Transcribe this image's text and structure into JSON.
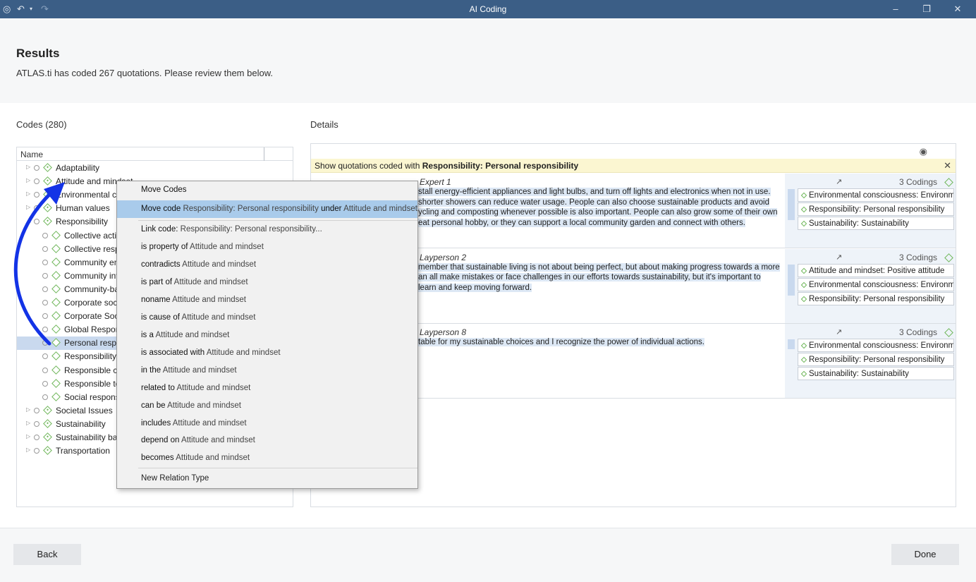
{
  "window": {
    "title": "AI Coding",
    "icons": [
      "app-icon",
      "undo-icon",
      "redo-icon"
    ],
    "controls": [
      "minimize-icon",
      "restore-icon",
      "close-icon"
    ]
  },
  "header": {
    "title": "Results",
    "subtitle": "ATLAS.ti has coded 267 quotations. Please review them below."
  },
  "codes": {
    "label": "Codes (280)",
    "column_name": "Name",
    "rows": [
      {
        "label": "Adaptability",
        "level": 0
      },
      {
        "label": "Attitude and mindset",
        "level": 0
      },
      {
        "label": "Environmental consciousness",
        "level": 0
      },
      {
        "label": "Human values",
        "level": 0
      },
      {
        "label": "Responsibility",
        "level": 0,
        "expanded": true
      },
      {
        "label": "Collective action",
        "level": 1
      },
      {
        "label": "Collective responsibility",
        "level": 1
      },
      {
        "label": "Community engagement",
        "level": 1
      },
      {
        "label": "Community involvement",
        "level": 1
      },
      {
        "label": "Community-based",
        "level": 1
      },
      {
        "label": "Corporate social",
        "level": 1
      },
      {
        "label": "Corporate Social",
        "level": 1
      },
      {
        "label": "Global Responsibility",
        "level": 1
      },
      {
        "label": "Personal responsibility",
        "level": 1,
        "selected": true
      },
      {
        "label": "Responsibility",
        "level": 1
      },
      {
        "label": "Responsible consumption",
        "level": 1
      },
      {
        "label": "Responsible tourism",
        "level": 1
      },
      {
        "label": "Social responsibility",
        "level": 1
      },
      {
        "label": "Societal Issues",
        "level": 0
      },
      {
        "label": "Sustainability",
        "level": 0
      },
      {
        "label": "Sustainability barriers",
        "level": 0
      },
      {
        "label": "Transportation",
        "level": 0
      }
    ]
  },
  "details": {
    "label": "Details",
    "filter_prefix": "Show quotations coded with ",
    "filter_code": "Responsibility: Personal responsibility",
    "quotations": [
      {
        "meta": "7:22 ¶ 15 in Interview - Expert 1",
        "meta_visible": "Expert 1",
        "text": "stall energy-efficient appliances and light bulbs, and turn off lights and electronics when not in use. shorter showers can reduce water usage. People can also choose sustainable products and avoid ycling and composting whenever possible is also important. People can also grow some of their own eat personal hobby, or they can support a local community garden and connect with others.",
        "codings_count": "3 Codings",
        "codes": [
          "Environmental consciousness: Environm...",
          "Responsibility: Personal responsibility",
          "Sustainability: Sustainability"
        ]
      },
      {
        "meta_visible": "Layperson 2",
        "text": "member that sustainable living is not about being perfect, but about making progress towards a more an all make mistakes or face challenges in our efforts towards sustainability, but it's important to learn and keep moving forward.",
        "codings_count": "3 Codings",
        "codes": [
          "Attitude and mindset: Positive attitude",
          "Environmental consciousness: Environm...",
          "Responsibility: Personal responsibility"
        ]
      },
      {
        "meta_visible": "Layperson 8",
        "text": "table for my sustainable choices and I recognize the power of individual actions.",
        "codings_count": "3 Codings",
        "codes": [
          "Environmental consciousness: Environm...",
          "Responsibility: Personal responsibility",
          "Sustainability: Sustainability"
        ]
      }
    ]
  },
  "context_menu": {
    "header": "Move Codes",
    "move_code": {
      "verb": "Move code",
      "source": "Responsibility: Personal responsibility",
      "under": "under",
      "target": "Attitude and mindset"
    },
    "link_code": {
      "verb": "Link code:",
      "rest": "Responsibility: Personal responsibility..."
    },
    "relations": [
      {
        "rel": "is property of",
        "target": "Attitude and mindset"
      },
      {
        "rel": "contradicts",
        "target": "Attitude and mindset"
      },
      {
        "rel": "is part of",
        "target": "Attitude and mindset"
      },
      {
        "rel": "noname",
        "target": "Attitude and mindset"
      },
      {
        "rel": "is cause of",
        "target": "Attitude and mindset"
      },
      {
        "rel": "is a",
        "target": "Attitude and mindset"
      },
      {
        "rel": "is associated with",
        "target": "Attitude and mindset"
      },
      {
        "rel": "in the",
        "target": "Attitude and mindset"
      },
      {
        "rel": "related to",
        "target": "Attitude and mindset"
      },
      {
        "rel": "can be",
        "target": "Attitude and mindset"
      },
      {
        "rel": "includes",
        "target": "Attitude and mindset"
      },
      {
        "rel": "depend on",
        "target": "Attitude and mindset"
      },
      {
        "rel": "becomes",
        "target": "Attitude and mindset"
      }
    ],
    "new_relation": "New Relation Type"
  },
  "footer": {
    "back_label": "Back",
    "done_label": "Done"
  },
  "colors": {
    "titlebar": "#3b5e86",
    "code_green": "#6fb75a",
    "highlight": "#a9cbeb",
    "annotation_arrow": "#1333e6"
  }
}
